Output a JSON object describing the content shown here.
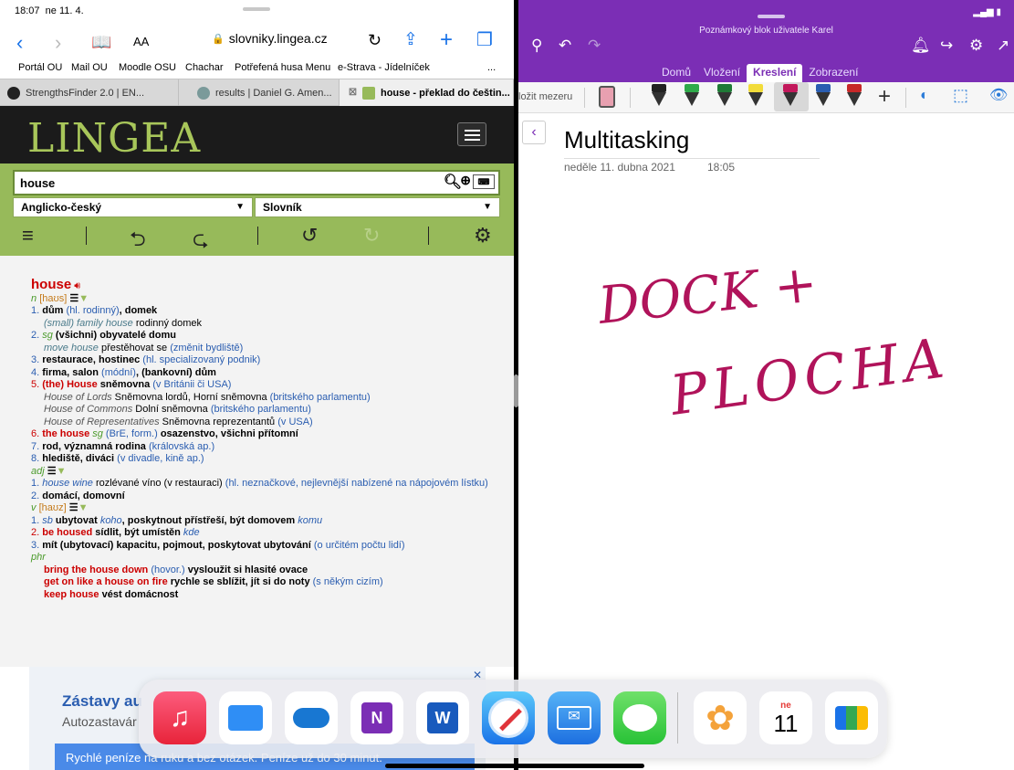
{
  "status": {
    "time": "18:07",
    "date": "ne 11. 4."
  },
  "safari": {
    "aa": "AA",
    "url": "slovniky.lingea.cz",
    "favorites": [
      "Portál OU",
      "Mail OU",
      "Moodle OSU",
      "Chachar",
      "Potřefená husa Menu",
      "e-Strava - Jídelníček",
      "..."
    ],
    "tabs": [
      {
        "label": "StrengthsFinder 2.0 | EN..."
      },
      {
        "label": "results | Daniel G. Amen..."
      },
      {
        "label": "house - překlad do češtin..."
      }
    ]
  },
  "lingea": {
    "logo": "LINGEA",
    "query": "house",
    "dictionary": "Anglicko-český",
    "type": "Slovník"
  },
  "entry": {
    "headword": "house",
    "pos_n": "n",
    "pron_n": "[haʊs]",
    "n1_main": "dům",
    "n1_note": "(hl. rodinný)",
    "n1_main2": ", domek",
    "n1_ex_en": "(small) family house",
    "n1_ex_cz": " rodinný domek",
    "n2_sg": "sg",
    "n2_main": "(všichni) obyvatelé domu",
    "n2_ex_en": "move house",
    "n2_ex_cz": " přestěhovat se ",
    "n2_ex_note": "(změnit bydliště)",
    "n3_main": "restaurace, hostinec",
    "n3_note": " (hl. specializovaný podnik)",
    "n4_main": "firma, salon",
    "n4_note": " (módní)",
    "n4_main2": ", (bankovní) dům",
    "n5_head": "(the) House",
    "n5_main": " sněmovna",
    "n5_note": " (v Británii či USA)",
    "n5_ex1_en": "House of Lords",
    "n5_ex1_cz": " Sněmovna lordů, Horní sněmovna ",
    "n5_ex1_note": "(britského parlamentu)",
    "n5_ex2_en": "House of Commons",
    "n5_ex2_cz": " Dolní sněmovna ",
    "n5_ex2_note": "(britského parlamentu)",
    "n5_ex3_en": "House of Representatives",
    "n5_ex3_cz": " Sněmovna reprezentantů ",
    "n5_ex3_note": "(v USA)",
    "n6_head": "the house",
    "n6_sg": "sg",
    "n6_note": " (BrE, form.)",
    "n6_main": " osazenstvo, všichni přítomní",
    "n7_main": "rod, významná rodina",
    "n7_note": " (královská ap.)",
    "n8_main": "hlediště, diváci",
    "n8_note": " (v divadle, kině ap.)",
    "pos_adj": "adj",
    "a1_en": "house wine",
    "a1_cz": " rozlévané víno (v restauraci) ",
    "a1_note": "(hl. neznačkové, nejlevnější nabízené na nápojovém lístku)",
    "a2_main": "domácí, domovní",
    "pos_v": "v",
    "pron_v": "[haʊz]",
    "v1_sb": "sb",
    "v1_main": " ubytovat ",
    "v1_koho": "koho",
    "v1_main2": ", poskytnout přístřeší, být domovem ",
    "v1_komu": "komu",
    "v2_head": "be housed",
    "v2_main": " sídlit, být umístěn ",
    "v2_kde": "kde",
    "v3_main": "mít (ubytovací) kapacitu, pojmout, poskytovat ubytování",
    "v3_note": " (o určitém počtu lidí)",
    "pos_phr": "phr",
    "p1_head": "bring the house down",
    "p1_note": " (hovor.)",
    "p1_main": " vysloužit si hlasité ovace",
    "p2_head": "get on like a house on fire",
    "p2_main": " rychle se sblížit, jít si do noty ",
    "p2_note": "(s někým cizím)",
    "p3_head": "keep house",
    "p3_main": " vést domácnost"
  },
  "ad": {
    "title": "Zástavy au",
    "subtitle": "Autozastavár",
    "button": "Rychlé peníze na ruku a bez otázek. Peníze už do 30 minut."
  },
  "onenote": {
    "notebook_title": "Poznámkový blok uživatele Karel",
    "tabs": [
      "Domů",
      "Vložení",
      "Kreslení",
      "Zobrazení"
    ],
    "active_tab": "Kreslení",
    "insert_space": "ložit mezeru",
    "note_title": "Multitasking",
    "note_date": "neděle 11. dubna 2021",
    "note_time": "18:05",
    "ink_line1": "DOCK +",
    "ink_line2": "PLOCHA",
    "ink_color": "#b0135a"
  },
  "dock": {
    "calendar_day": "ne",
    "calendar_num": "11",
    "apps": [
      "music-app",
      "files-app",
      "onedrive-app",
      "onenote-app",
      "word-app",
      "safari-app",
      "mail-app",
      "messages-app",
      "photos-app",
      "calendar-app",
      "meet-app"
    ]
  }
}
